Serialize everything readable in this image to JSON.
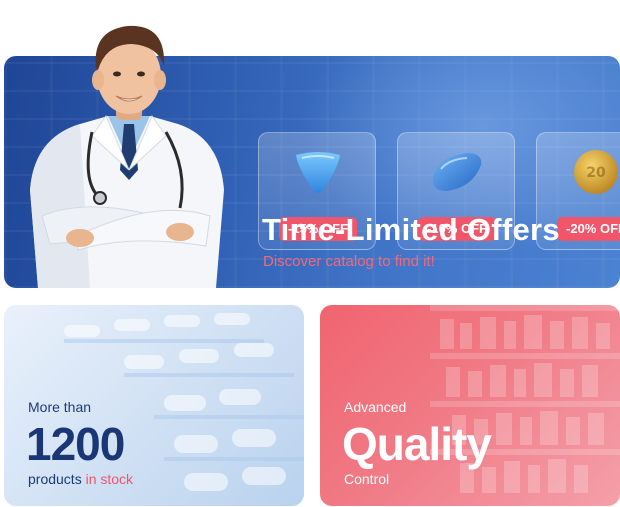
{
  "hero": {
    "title": "Time-Limited Offers",
    "subtitle": "Discover catalog to find it!",
    "offers": [
      {
        "badge": "-15% OFF",
        "pill_color": "#4aa6ee",
        "pill_shape": "triangle-pill"
      },
      {
        "badge": "-10% OFF",
        "pill_color": "#3d8ddf",
        "pill_shape": "diamond-pill"
      },
      {
        "badge": "-20% OFF",
        "pill_color": "#d6a132",
        "pill_shape": "round-pill"
      }
    ]
  },
  "stock_card": {
    "line1": "More than",
    "number": "1200",
    "line3_a": "products",
    "line3_b": "in stock"
  },
  "quality_card": {
    "line1": "Advanced",
    "big": "Quality",
    "line3": "Control"
  },
  "colors": {
    "brand_blue": "#1f4596",
    "accent_red": "#f0556a",
    "navy_text": "#1b3674"
  }
}
